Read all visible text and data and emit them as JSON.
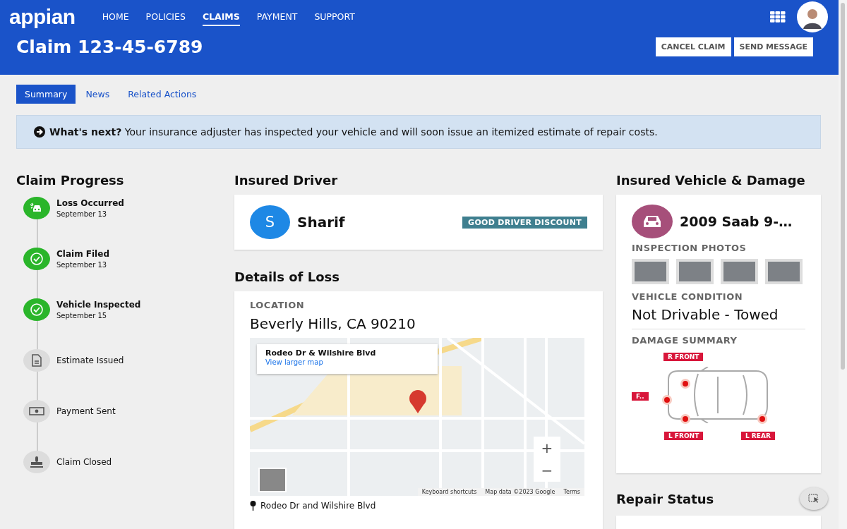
{
  "header": {
    "logo": "appian",
    "nav": [
      {
        "label": "HOME",
        "selected": false
      },
      {
        "label": "POLICIES",
        "selected": false
      },
      {
        "label": "CLAIMS",
        "selected": true
      },
      {
        "label": "PAYMENT",
        "selected": false
      },
      {
        "label": "SUPPORT",
        "selected": false
      }
    ],
    "title": "Claim 123-45-6789",
    "buttons": [
      "CANCEL CLAIM",
      "SEND MESSAGE"
    ]
  },
  "tabs": [
    {
      "label": "Summary",
      "selected": true
    },
    {
      "label": "News",
      "selected": false
    },
    {
      "label": "Related Actions",
      "selected": false
    }
  ],
  "banner": {
    "text": "**What's next?** Your insurance adjuster has inspected your vehicle and will soon issue an itemized estimate of repair costs."
  },
  "progress": {
    "title": "Claim Progress",
    "steps": [
      {
        "label": "Loss Occurred",
        "date": "September 13",
        "done": true
      },
      {
        "label": "Claim Filed",
        "date": "September 13",
        "done": true
      },
      {
        "label": "Vehicle Inspected",
        "date": "September 15",
        "done": true
      },
      {
        "label": "Estimate Issued",
        "done": false
      },
      {
        "label": "Payment Sent",
        "done": false
      },
      {
        "label": "Claim Closed",
        "done": false
      }
    ]
  },
  "driver": {
    "title": "Insured Driver",
    "initial": "S",
    "name": "Sharif",
    "badge": "GOOD DRIVER DISCOUNT"
  },
  "loss": {
    "title": "Details of Loss",
    "location_label": "LOCATION",
    "location": "Beverly Hills, CA 90210",
    "map": {
      "place": "Rodeo Dr & Wilshire Blvd",
      "link": "View larger map",
      "zoom_in": "+",
      "zoom_out": "−",
      "footer": [
        "Keyboard shortcuts",
        "Map data ©2023 Google",
        "Terms"
      ]
    },
    "address": "Rodeo Dr and Wilshire Blvd"
  },
  "vehicle": {
    "title": "Insured Vehicle & Damage",
    "name": "2009 Saab 9-…",
    "photos_label": "INSPECTION PHOTOS",
    "condition_label": "VEHICLE CONDITION",
    "condition": "Not Drivable - Towed",
    "damage_label": "DAMAGE SUMMARY",
    "damage": [
      {
        "label": "R FRONT",
        "kind": "right-front"
      },
      {
        "label": "F..",
        "kind": "front"
      },
      {
        "label": "L FRONT",
        "kind": "left-front"
      },
      {
        "label": "L REAR",
        "kind": "left-rear"
      }
    ]
  },
  "repair": {
    "title": "Repair Status"
  }
}
